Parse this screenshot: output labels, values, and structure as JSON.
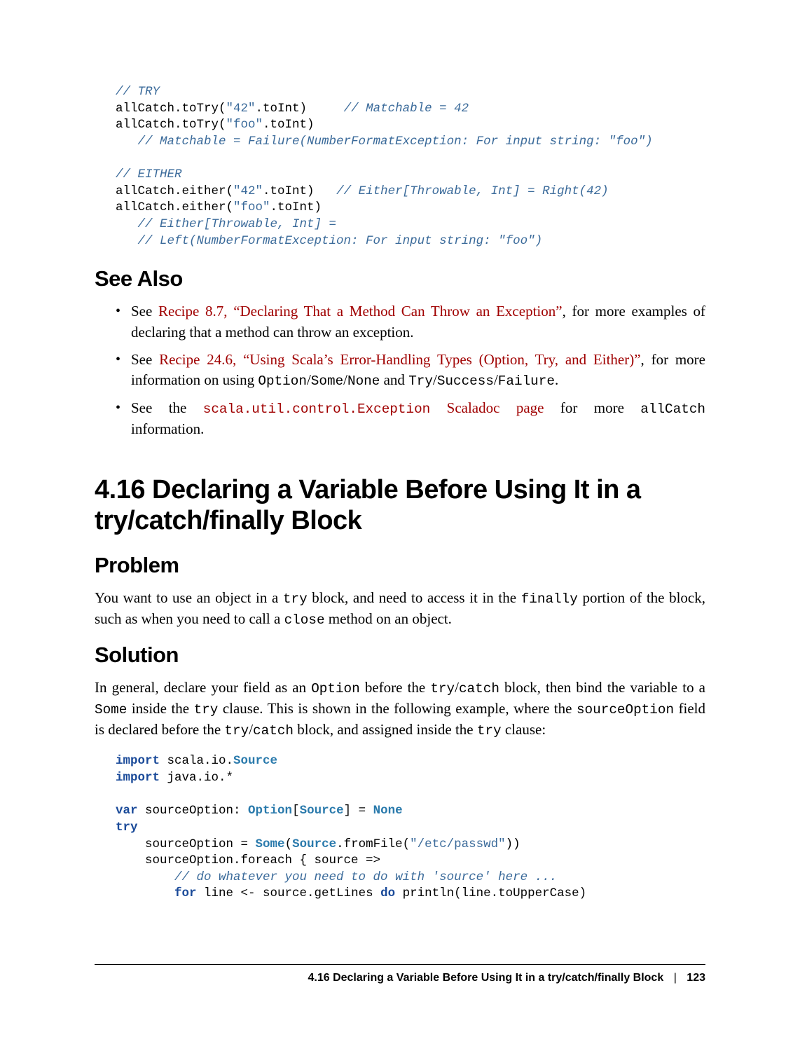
{
  "code1": {
    "l1": "// TRY",
    "l2a": "allCatch.toTry(",
    "l2b": "\"42\"",
    "l2c": ".toInt)     ",
    "l2d": "// Matchable = 42",
    "l3a": "allCatch.toTry(",
    "l3b": "\"foo\"",
    "l3c": ".toInt)",
    "l4": "   // Matchable = Failure(NumberFormatException: For input string: \"foo\")",
    "l5": "",
    "l6": "// EITHER",
    "l7a": "allCatch.either(",
    "l7b": "\"42\"",
    "l7c": ".toInt)   ",
    "l7d": "// Either[Throwable, Int] = Right(42)",
    "l8a": "allCatch.either(",
    "l8b": "\"foo\"",
    "l8c": ".toInt)",
    "l9": "   // Either[Throwable, Int] =",
    "l10": "   // Left(NumberFormatException: For input string: \"foo\")"
  },
  "headings": {
    "see_also": "See Also",
    "section": "4.16 Declaring a Variable Before Using It in a try/catch/finally Block",
    "problem": "Problem",
    "solution": "Solution"
  },
  "bullets": {
    "b1_pre": "See ",
    "b1_link": "Recipe 8.7, “Declaring That a Method Can Throw an Exception”",
    "b1_post": ", for more examples of declaring that a method can throw an exception.",
    "b2_pre": "See ",
    "b2_link": "Recipe 24.6, “Using Scala’s Error-Handling Types (Option, Try, and Either)”",
    "b2_post_a": ", for more information on using ",
    "b2_mono_a": "Option",
    "b2_slash1": "/",
    "b2_mono_b": "Some",
    "b2_slash2": "/",
    "b2_mono_c": "None",
    "b2_and": " and ",
    "b2_mono_d": "Try",
    "b2_slash3": "/",
    "b2_mono_e": "Success",
    "b2_slash4": "/",
    "b2_mono_f": "Failure",
    "b2_end": ".",
    "b3_pre": "See the ",
    "b3_link_a": "scala.util.control.Exception",
    "b3_link_b": " Scaladoc page",
    "b3_post_a": " for more ",
    "b3_mono": "allCatch",
    "b3_post_b": " information."
  },
  "problem_para": {
    "a": "You want to use an object in a ",
    "m1": "try",
    "b": " block, and need to access it in the ",
    "m2": "finally",
    "c": " portion of the block, such as when you need to call a ",
    "m3": "close",
    "d": " method on an object."
  },
  "solution_para": {
    "a": "In general, declare your field as an ",
    "m1": "Option",
    "b": " before the ",
    "m2": "try",
    "c": "/",
    "m3": "catch",
    "d": " block, then bind the variable to a ",
    "m4": "Some",
    "e": " inside the ",
    "m5": "try",
    "f": " clause. This is shown in the following example, where the ",
    "m6": "sourceOption",
    "g": " field is declared before the ",
    "m7": "try",
    "h": "/",
    "m8": "catch",
    "i": " block, and assigned inside the ",
    "m9": "try",
    "j": " clause:"
  },
  "code2": {
    "l1a": "import",
    "l1b": " scala.io.",
    "l1c": "Source",
    "l2a": "import",
    "l2b": " java.io.*",
    "l3": "",
    "l4a": "var",
    "l4b": " sourceOption: ",
    "l4c": "Option",
    "l4d": "[",
    "l4e": "Source",
    "l4f": "] = ",
    "l4g": "None",
    "l5a": "try",
    "l6a": "    sourceOption = ",
    "l6b": "Some",
    "l6c": "(",
    "l6d": "Source",
    "l6e": ".fromFile(",
    "l6f": "\"/etc/passwd\"",
    "l6g": "))",
    "l7": "    sourceOption.foreach { source =>",
    "l8": "        // do whatever you need to do with 'source' here ...",
    "l9a": "        ",
    "l9b": "for",
    "l9c": " line <- source.getLines ",
    "l9d": "do",
    "l9e": " println(line.toUpperCase)"
  },
  "footer": {
    "title": "4.16 Declaring a Variable Before Using It in a try/catch/finally Block",
    "sep": "|",
    "page": "123"
  }
}
